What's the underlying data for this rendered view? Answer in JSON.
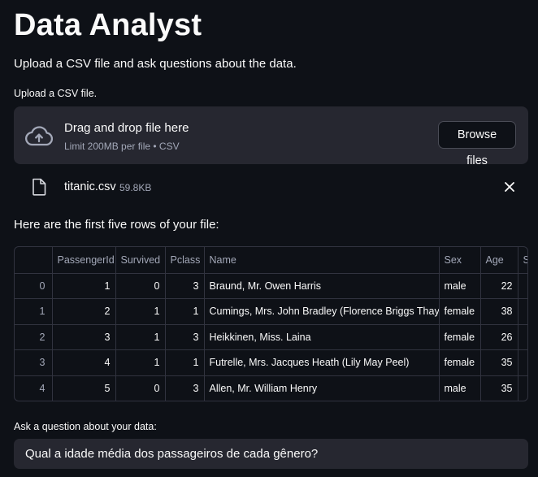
{
  "header": {
    "title": "Data Analyst",
    "subtitle": "Upload a CSV file and ask questions about the data."
  },
  "uploader": {
    "label": "Upload a CSV file.",
    "drop_text": "Drag and drop file here",
    "limit_text": "Limit 200MB per file • CSV",
    "browse_label": "Browse files",
    "icon": "cloud-upload-icon"
  },
  "uploaded_file": {
    "name": "titanic.csv",
    "size": "59.8KB",
    "icon": "file-icon",
    "remove_icon": "close-icon"
  },
  "preview": {
    "intro": "Here are the first five rows of your file:",
    "columns": [
      "",
      "PassengerId",
      "Survived",
      "Pclass",
      "Name",
      "Sex",
      "Age",
      "S"
    ],
    "rows": [
      [
        "0",
        "1",
        "0",
        "3",
        "Braund, Mr. Owen Harris",
        "male",
        "22",
        ""
      ],
      [
        "1",
        "2",
        "1",
        "1",
        "Cumings, Mrs. John Bradley (Florence Briggs Thayer)",
        "female",
        "38",
        ""
      ],
      [
        "2",
        "3",
        "1",
        "3",
        "Heikkinen, Miss. Laina",
        "female",
        "26",
        ""
      ],
      [
        "3",
        "4",
        "1",
        "1",
        "Futrelle, Mrs. Jacques Heath (Lily May Peel)",
        "female",
        "35",
        ""
      ],
      [
        "4",
        "5",
        "0",
        "3",
        "Allen, Mr. William Henry",
        "male",
        "35",
        ""
      ]
    ]
  },
  "question": {
    "label": "Ask a question about your data:",
    "value": "Qual a idade média dos passageiros de cada gênero?"
  },
  "colors": {
    "background": "#0e1117",
    "surface": "#262730",
    "border": "#31333f",
    "muted_text": "#a3a8b8",
    "text": "#fafafa"
  }
}
